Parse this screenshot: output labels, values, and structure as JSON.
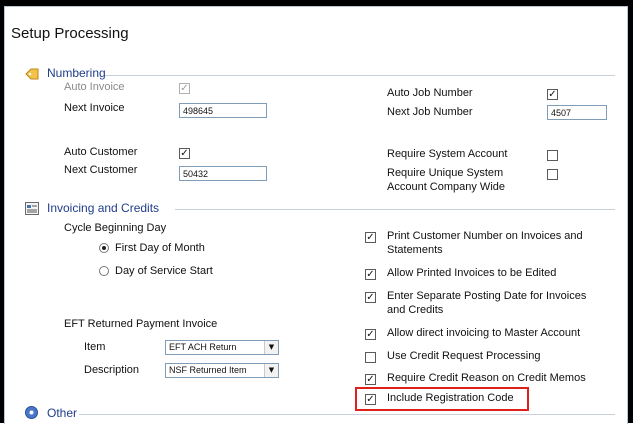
{
  "page_title": "Setup Processing",
  "numbering": {
    "header": "Numbering",
    "auto_invoice_label": "Auto Invoice",
    "auto_invoice_checked": true,
    "next_invoice_label": "Next Invoice",
    "next_invoice_value": "498645",
    "auto_customer_label": "Auto Customer",
    "auto_customer_checked": true,
    "next_customer_label": "Next Customer",
    "next_customer_value": "50432",
    "auto_job_label": "Auto Job Number",
    "auto_job_checked": true,
    "next_job_label": "Next Job Number",
    "next_job_value": "4507",
    "require_system_account_label": "Require System Account",
    "require_unique_label_line1": "Require Unique System",
    "require_unique_label_line2": "Account Company Wide"
  },
  "invoicing": {
    "header": "Invoicing and Credits",
    "cycle_label": "Cycle Beginning Day",
    "radio_first": "First Day of Month",
    "radio_service": "Day of Service Start",
    "eft_label": "EFT Returned Payment Invoice",
    "item_label": "Item",
    "item_value": "EFT ACH Return",
    "description_label": "Description",
    "description_value": "NSF Returned Item",
    "options": [
      {
        "line1": "Print Customer Number on Invoices and",
        "line2": "Statements",
        "checked": true
      },
      {
        "line1": "Allow Printed Invoices to be Edited",
        "line2": "",
        "checked": true
      },
      {
        "line1": "Enter Separate Posting Date for Invoices",
        "line2": "and Credits",
        "checked": true
      },
      {
        "line1": "Allow direct invoicing to Master Account",
        "line2": "",
        "checked": true
      },
      {
        "line1": "Use Credit Request Processing",
        "line2": "",
        "checked": false
      },
      {
        "line1": "Require Credit Reason on Credit Memos",
        "line2": "",
        "checked": true
      },
      {
        "line1": "Include Registration Code",
        "line2": "",
        "checked": true
      }
    ]
  },
  "other": {
    "header": "Other"
  },
  "colors": {
    "header_text": "#1f3d8a",
    "highlight": "#e0201a"
  },
  "icons": [
    "numbering-icon",
    "invoicing-icon",
    "other-icon",
    "dropdown-arrow-icon",
    "checkmark-icon"
  ]
}
